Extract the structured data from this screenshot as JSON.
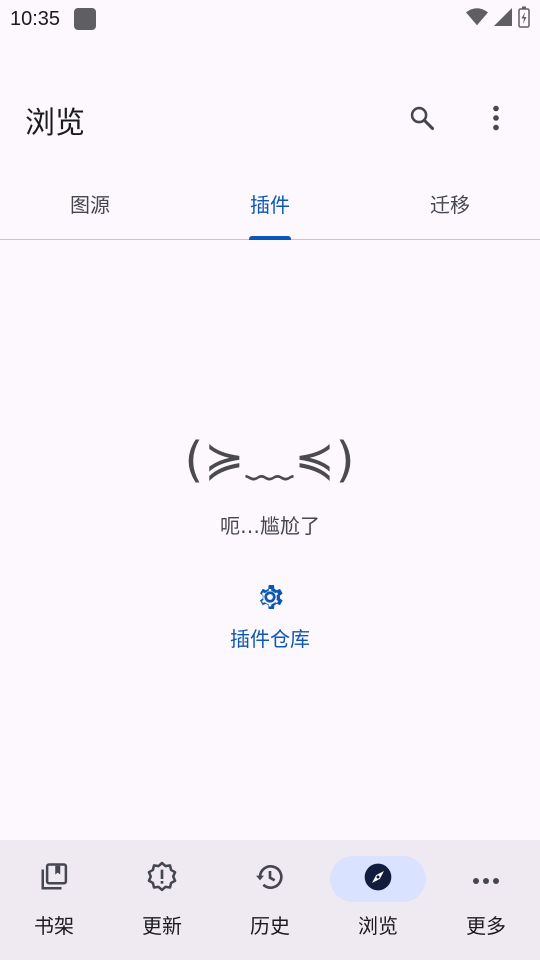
{
  "status_bar": {
    "time": "10:35"
  },
  "app_bar": {
    "title": "浏览",
    "actions": [
      {
        "icon": "search-icon"
      },
      {
        "icon": "more-vert-icon"
      }
    ]
  },
  "tabs": [
    {
      "label": "图源",
      "active": false
    },
    {
      "label": "插件",
      "active": true
    },
    {
      "label": "迁移",
      "active": false
    }
  ],
  "empty_state": {
    "kaomoji": "(≽﹏≼)",
    "message": "呃…尴尬了",
    "action": {
      "icon": "gear-icon",
      "label": "插件仓库"
    }
  },
  "bottom_nav": [
    {
      "label": "书架",
      "icon": "library-icon",
      "active": false
    },
    {
      "label": "更新",
      "icon": "new-releases-icon",
      "active": false
    },
    {
      "label": "历史",
      "icon": "history-icon",
      "active": false
    },
    {
      "label": "浏览",
      "icon": "explore-icon",
      "active": true
    },
    {
      "label": "更多",
      "icon": "more-horiz-icon",
      "active": false
    }
  ],
  "colors": {
    "accent": "#0b57b3",
    "background": "#fdf8fd",
    "nav_background": "#efeaf1",
    "nav_active_pill": "#d9e2ff"
  }
}
